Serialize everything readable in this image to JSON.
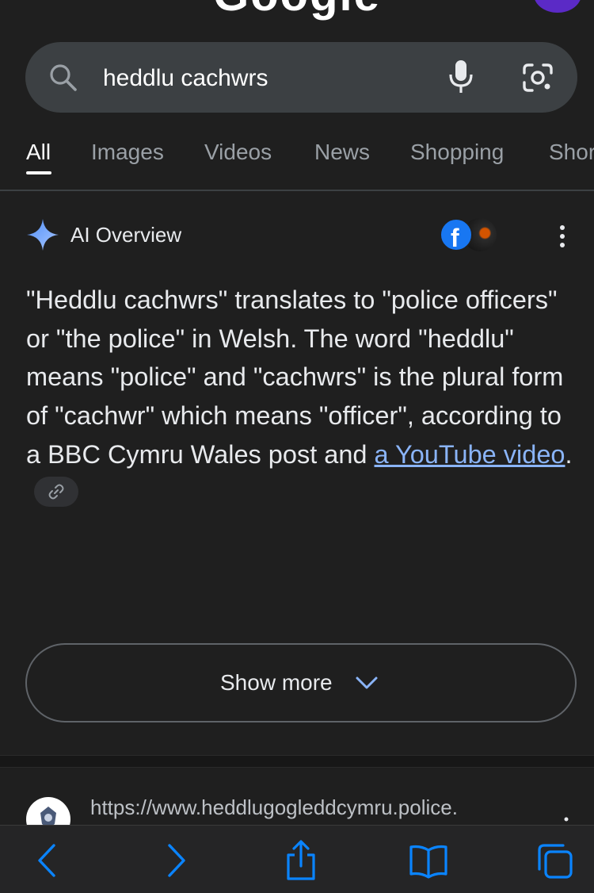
{
  "header": {
    "logo_text": "Google"
  },
  "search": {
    "query": "heddlu cachwrs"
  },
  "tabs": [
    {
      "label": "All",
      "active": true
    },
    {
      "label": "Images",
      "active": false
    },
    {
      "label": "Videos",
      "active": false
    },
    {
      "label": "News",
      "active": false
    },
    {
      "label": "Shopping",
      "active": false
    },
    {
      "label": "Shor",
      "active": false
    }
  ],
  "ai_overview": {
    "title": "AI Overview",
    "sources": [
      "facebook-icon",
      "youtube-thumbnail"
    ],
    "body_text": "\"Heddlu cachwrs\" translates to \"police officers\" or \"the police\" in Welsh. The word \"heddlu\" means \"police\" and \"cachwrs\" is the plural form of \"cachwr\" which means \"officer\", according to a BBC Cymru Wales post and ",
    "link_text": "a YouTube video",
    "after_link": ".",
    "show_more_label": "Show more"
  },
  "result": {
    "url": "https://www.heddlugogleddcymru.police."
  },
  "colors": {
    "background": "#1f1f1f",
    "search_bar": "#3c4043",
    "link": "#8ab4f8",
    "safari_accent": "#0a84ff"
  }
}
